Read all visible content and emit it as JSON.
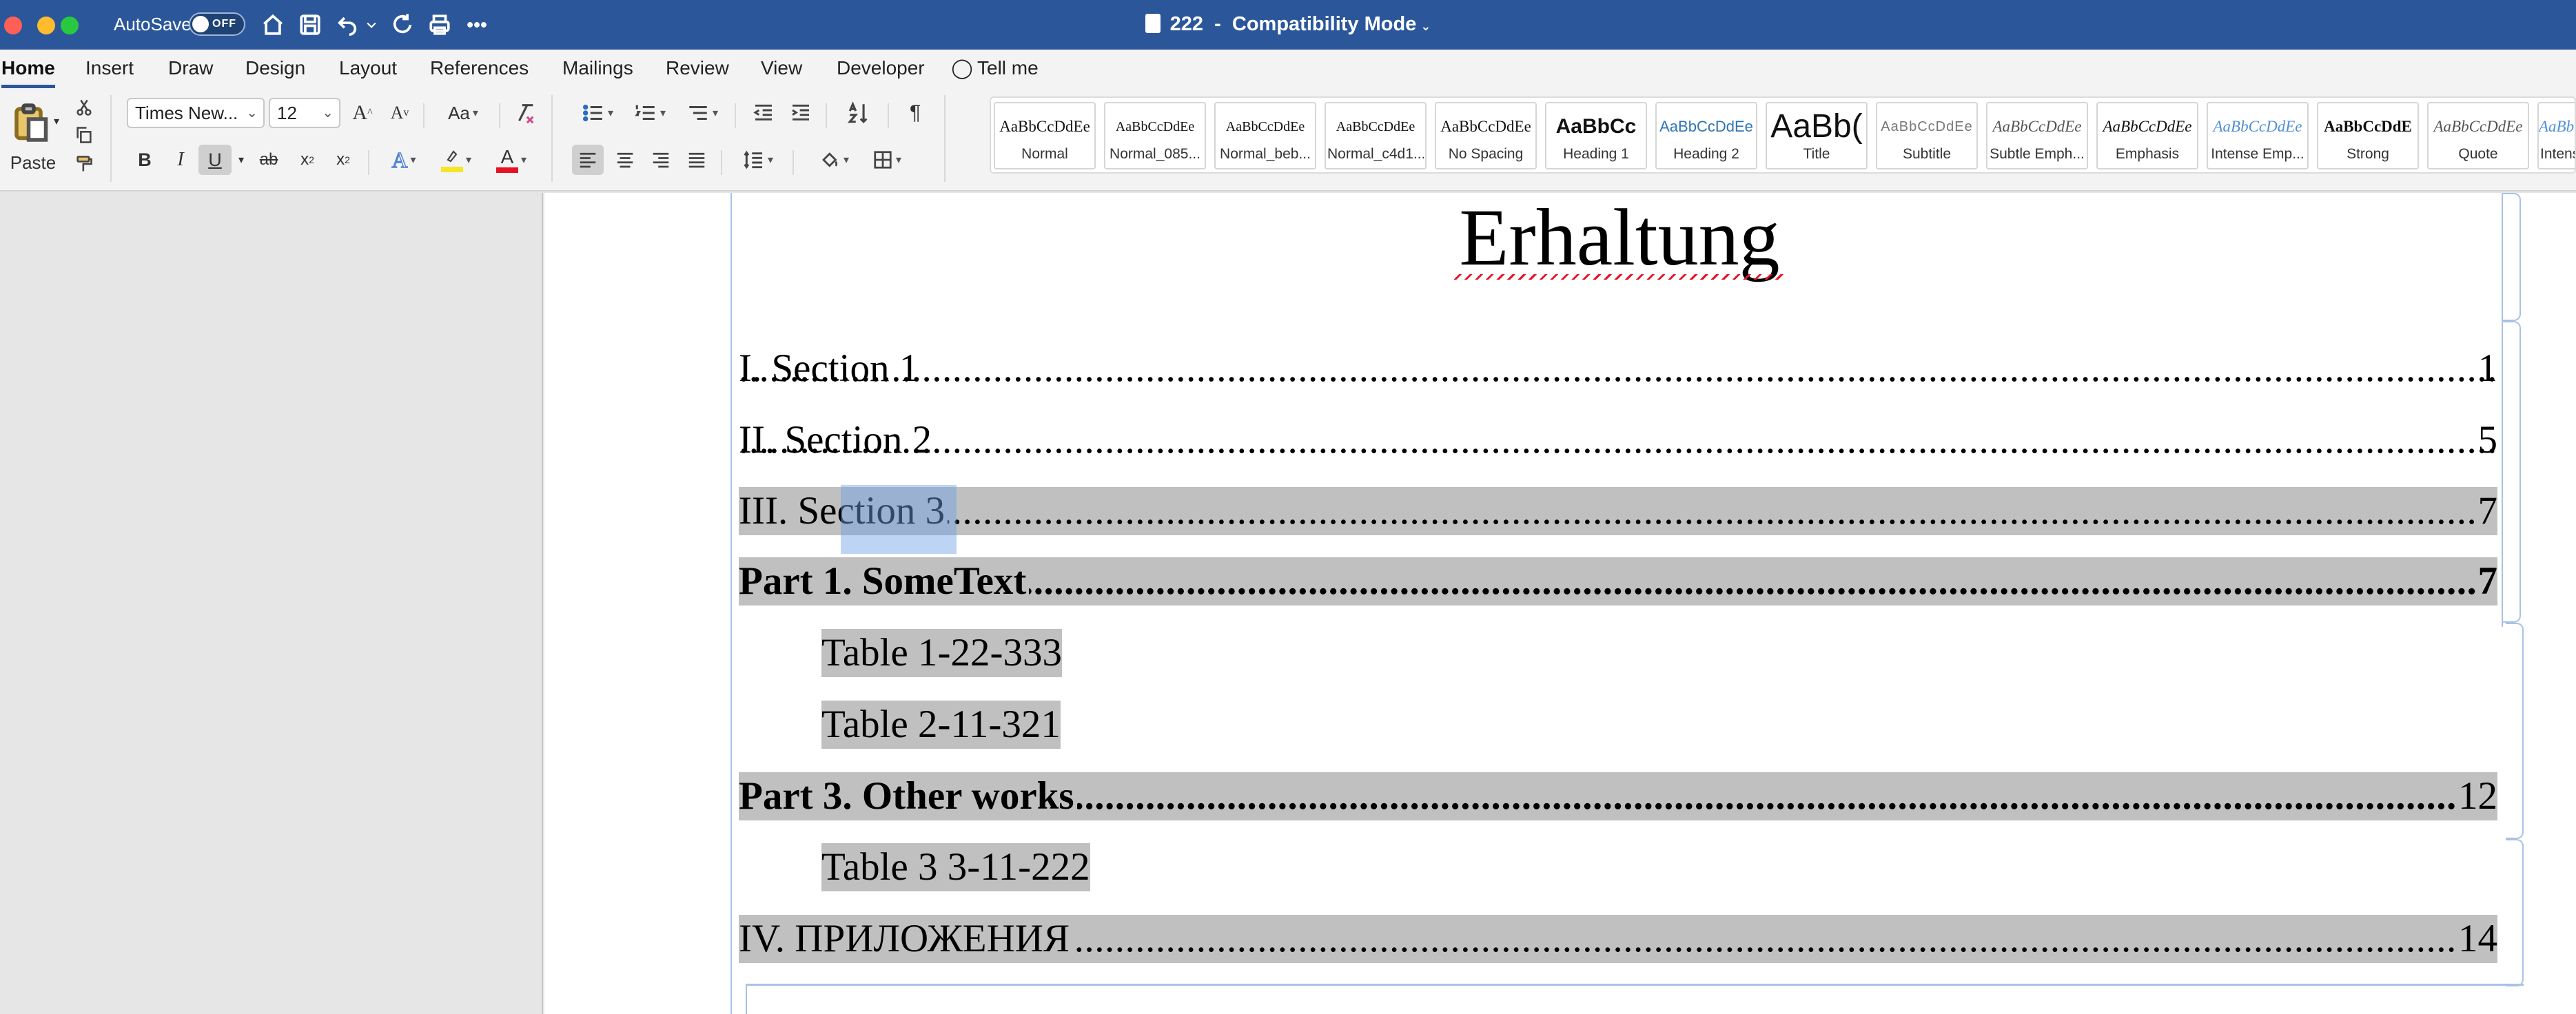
{
  "titlebar": {
    "autosave_label": "AutoSave",
    "autosave_state": "OFF",
    "doc_name": "222",
    "doc_mode": "Compatibility Mode",
    "title_sep": "-"
  },
  "tabs": [
    {
      "label": "Home",
      "active": true
    },
    {
      "label": "Insert"
    },
    {
      "label": "Draw"
    },
    {
      "label": "Design"
    },
    {
      "label": "Layout"
    },
    {
      "label": "References"
    },
    {
      "label": "Mailings"
    },
    {
      "label": "Review"
    },
    {
      "label": "View"
    },
    {
      "label": "Developer"
    },
    {
      "label": "Tell me"
    }
  ],
  "ribbon": {
    "paste_label": "Paste",
    "font_name": "Times New...",
    "font_size": "12",
    "grow_font": "A",
    "shrink_font": "A",
    "change_case": "Aa",
    "bold": "B",
    "italic": "I",
    "underline": "U",
    "strike": "ab",
    "subscript": "x",
    "superscript": "x",
    "sub_mark": "2",
    "sup_mark": "2",
    "font_color_glyph": "A",
    "highlight_color": "#f5e625",
    "font_color": "#e81123"
  },
  "styles": [
    {
      "preview": "AaBbCcDdEe",
      "name": "Normal"
    },
    {
      "preview": "AaBbCcDdEe",
      "name": "Normal_085..."
    },
    {
      "preview": "AaBbCcDdEe",
      "name": "Normal_beb..."
    },
    {
      "preview": "AaBbCcDdEe",
      "name": "Normal_c4d1..."
    },
    {
      "preview": "AaBbCcDdEe",
      "name": "No Spacing"
    },
    {
      "preview": "AaBbCc",
      "name": "Heading 1"
    },
    {
      "preview": "AaBbCcDdEe",
      "name": "Heading 2"
    },
    {
      "preview": "AaBb(",
      "name": "Title"
    },
    {
      "preview": "AaBbCcDdEe",
      "name": "Subtitle"
    },
    {
      "preview": "AaBbCcDdEe",
      "name": "Subtle Emph..."
    },
    {
      "preview": "AaBbCcDdEe",
      "name": "Emphasis"
    },
    {
      "preview": "AaBbCcDdEe",
      "name": "Intense Emp..."
    },
    {
      "preview": "AaBbCcDdE",
      "name": "Strong"
    },
    {
      "preview": "AaBbCcDdEe",
      "name": "Quote"
    },
    {
      "preview": "AaBbCcDdEe",
      "name": "Intens"
    }
  ],
  "document": {
    "heading": "Erhaltung",
    "toc": [
      {
        "text": "I. Section 1",
        "page": "1"
      },
      {
        "text": "II. Section 2",
        "page": "5"
      },
      {
        "text": "III. Section 3",
        "page": "7"
      },
      {
        "text": "Part 1. SomeText",
        "page": "7"
      },
      {
        "text": "Table 1-22-333"
      },
      {
        "text": "Table 2-11-321"
      },
      {
        "text": "Part 3. Other works",
        "page": "12"
      },
      {
        "text": "Table 3 3-11-222"
      },
      {
        "text": "IV. ПРИЛОЖЕНИЯ",
        "page": "14"
      }
    ]
  }
}
